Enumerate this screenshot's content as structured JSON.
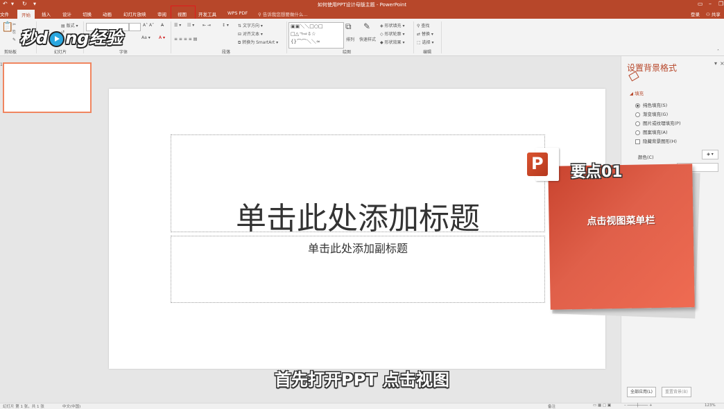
{
  "window": {
    "title": "如何使用PPT设计母版主题 - PowerPoint",
    "login": "登录",
    "share": "共享"
  },
  "tabs": [
    "文件",
    "开始",
    "插入",
    "设计",
    "切换",
    "动画",
    "幻灯片放映",
    "审阅",
    "视图",
    "开发工具",
    "WPS PDF"
  ],
  "active_tab": "开始",
  "highlighted_tab": "视图",
  "tell_me": "告诉我您想要做什么...",
  "ribbon": {
    "groups": [
      "剪贴板",
      "幻灯片",
      "字体",
      "段落",
      "绘图",
      "编辑"
    ],
    "items": {
      "layout": "版式",
      "text_direction": "文字方向",
      "align_text": "对齐文本",
      "convert_smartart": "转换为 SmartArt",
      "arrange": "排列",
      "quick_styles": "快速样式",
      "shape_fill": "形状填充",
      "shape_outline": "形状轮廓",
      "shape_effects": "形状效果",
      "find": "查找",
      "replace": "替换",
      "select": "选择"
    }
  },
  "watermark": {
    "text_before": "秒d",
    "text_after": "ng经验"
  },
  "slide": {
    "number": "1",
    "title_placeholder": "单击此处添加标题",
    "subtitle_placeholder": "单击此处添加副标题"
  },
  "format_pane": {
    "title": "设置背景格式",
    "fill_section": "填充",
    "options": [
      {
        "label": "纯色填充(S)",
        "selected": true
      },
      {
        "label": "渐变填充(G)",
        "selected": false
      },
      {
        "label": "图片或纹理填充(P)",
        "selected": false
      },
      {
        "label": "图案填充(A)",
        "selected": false
      }
    ],
    "hide_bg": "隐藏背景图形(H)",
    "color_label": "颜色(C)",
    "apply_all": "全部应用(L)",
    "reset_bg": "重置背景(B)"
  },
  "callout": {
    "keypoint": "要点01",
    "text": "点击视图菜单栏"
  },
  "caption": "首先打开PPT 点击视图",
  "statusbar": {
    "slide_info": "幻灯片 第 1 张，共 1 张",
    "language": "中文(中国)",
    "notes": "备注",
    "zoom": "123%"
  }
}
